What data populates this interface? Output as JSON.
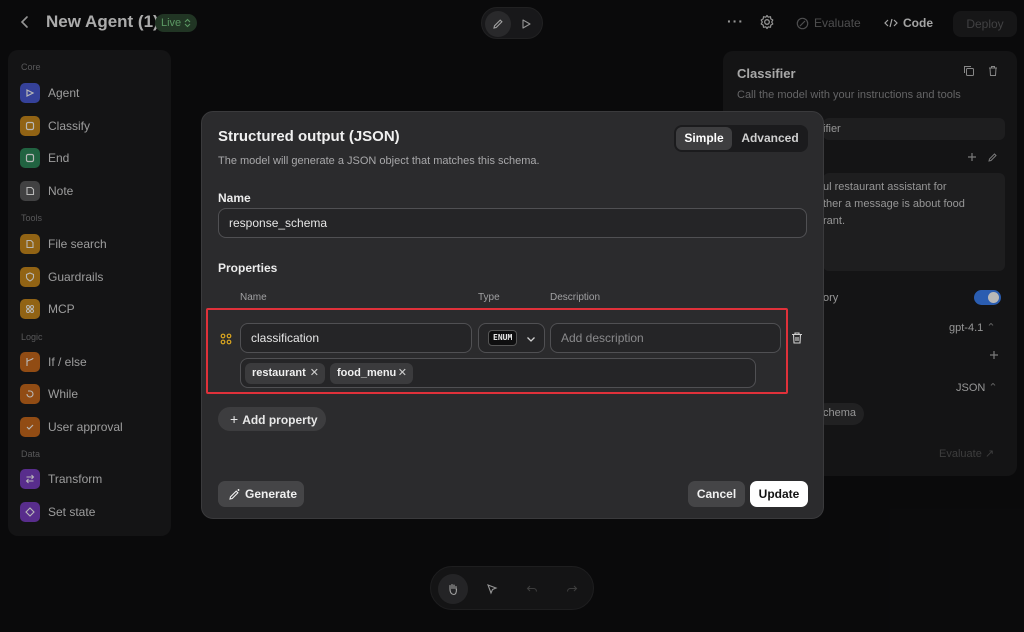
{
  "header": {
    "back_icon": "chevron-left-icon",
    "title": "New Agent (1)",
    "live_badge": "Live",
    "evaluate": "Evaluate",
    "code": "Code",
    "deploy": "Deploy"
  },
  "sidebar": {
    "sections": {
      "core": "Core",
      "tools": "Tools",
      "logic": "Logic",
      "data": "Data"
    },
    "items": [
      {
        "label": "Agent",
        "color": "#4a5bd4"
      },
      {
        "label": "Classify",
        "color": "#c98a1c"
      },
      {
        "label": "End",
        "color": "#2f8a5a"
      },
      {
        "label": "Note",
        "color": "#5a5a5c"
      },
      {
        "label": "File search",
        "color": "#c98a1c"
      },
      {
        "label": "Guardrails",
        "color": "#c98a1c"
      },
      {
        "label": "MCP",
        "color": "#c98a1c"
      },
      {
        "label": "If / else",
        "color": "#c96a1c"
      },
      {
        "label": "While",
        "color": "#c96a1c"
      },
      {
        "label": "User approval",
        "color": "#c96a1c"
      },
      {
        "label": "Transform",
        "color": "#7a3fc2"
      },
      {
        "label": "Set state",
        "color": "#7a3fc2"
      }
    ]
  },
  "right_panel": {
    "title": "Classifier",
    "subtitle": "Call the model with your instructions and tools",
    "name_value": "ifier",
    "prompt_lines": [
      "ul restaurant assistant for",
      "ther a message is about food",
      "rant."
    ],
    "history_label": "ory",
    "model": "gpt-4.1",
    "output_format": "JSON",
    "schema_chip": "chema",
    "evaluate_link": "Evaluate"
  },
  "modal": {
    "title": "Structured output (JSON)",
    "subtitle": "The model will generate a JSON object that matches this schema.",
    "tabs": {
      "simple": "Simple",
      "advanced": "Advanced"
    },
    "name_label": "Name",
    "name_value": "response_schema",
    "properties_label": "Properties",
    "columns": {
      "name": "Name",
      "type": "Type",
      "description": "Description"
    },
    "property": {
      "name": "classification",
      "type": "ENUM",
      "description_placeholder": "Add description",
      "enum_values": [
        "restaurant",
        "food_menu"
      ]
    },
    "add_property": "Add property",
    "generate": "Generate",
    "cancel": "Cancel",
    "update": "Update"
  }
}
